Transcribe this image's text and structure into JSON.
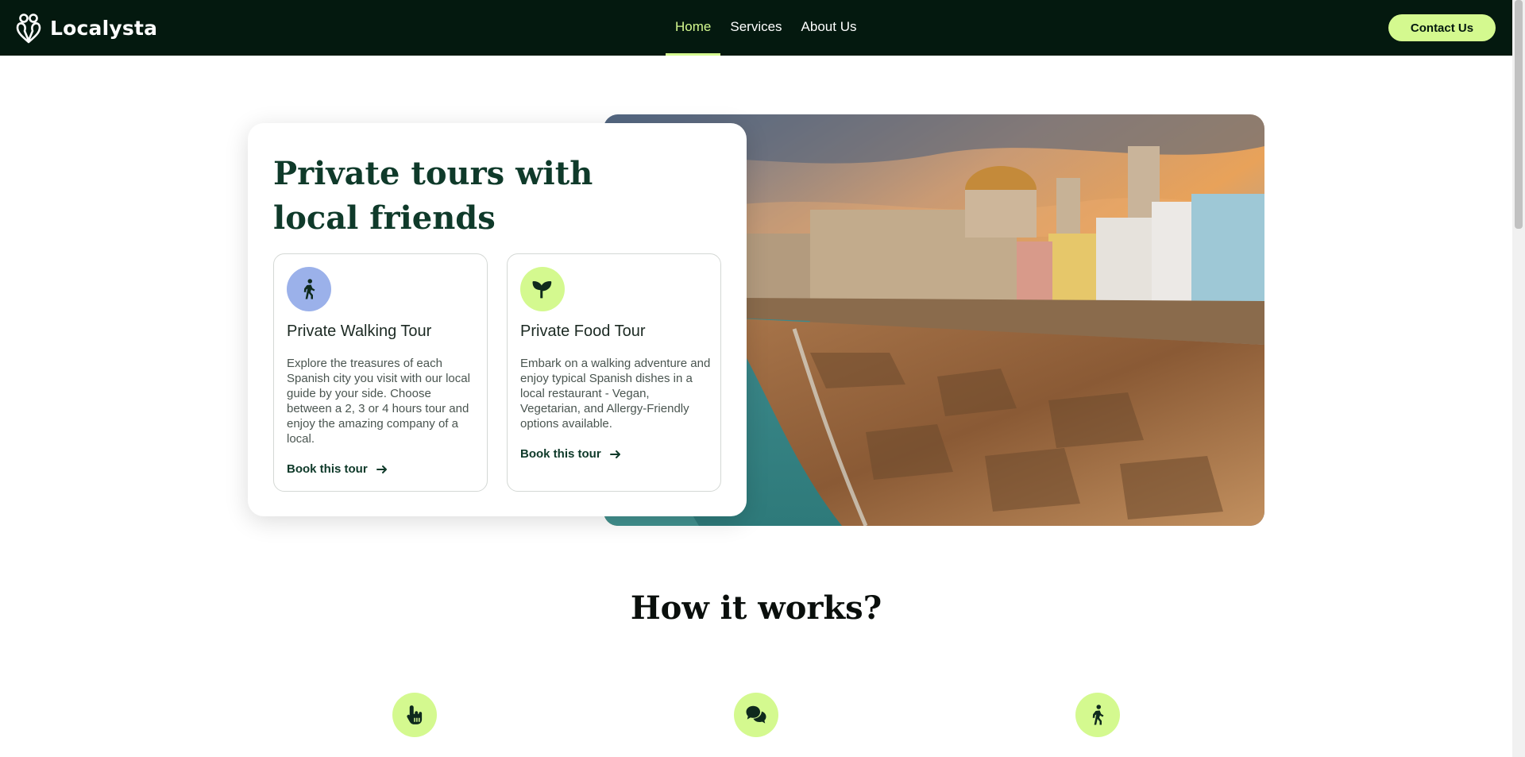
{
  "brand": {
    "name": "Localysta"
  },
  "nav": {
    "items": [
      {
        "label": "Home",
        "active": true
      },
      {
        "label": "Services",
        "active": false
      },
      {
        "label": "About Us",
        "active": false
      }
    ],
    "contact_label": "Contact Us"
  },
  "hero": {
    "title": "Private tours with local friends",
    "image_icon": "cadiz-cathedral-seafront-photo",
    "tours": [
      {
        "icon": "walking-person-icon",
        "title": "Private Walking Tour",
        "description": "Explore the treasures of each Spanish city you visit with our local guide by your side. Choose between a 2, 3 or 4 hours tour and enjoy the amazing company of a local.",
        "link_label": "Book this tour"
      },
      {
        "icon": "sprout-icon",
        "title": "Private Food Tour",
        "description": "Embark on a walking adventure and enjoy typical Spanish dishes in a local restaurant - Vegan, Vegetarian, and Allergy-Friendly options available.",
        "link_label": "Book this tour"
      }
    ]
  },
  "how_it_works": {
    "title": "How it works?",
    "steps": [
      {
        "icon": "pointing-hand-icon"
      },
      {
        "icon": "chat-bubbles-icon"
      },
      {
        "icon": "walking-person-icon"
      }
    ]
  },
  "colors": {
    "nav_bg": "#04190f",
    "accent": "#d4f98f",
    "heading": "#0f3a2a",
    "walk_icon_bg": "#9bb1ea"
  }
}
